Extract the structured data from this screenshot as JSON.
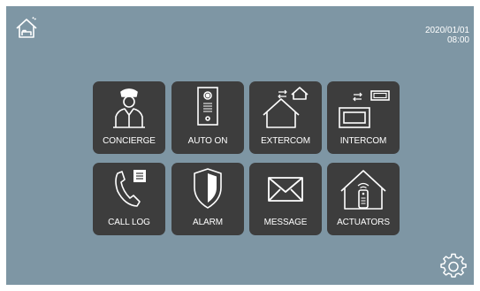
{
  "status": {
    "date": "2020/01/01",
    "time": "08:00"
  },
  "icons": {
    "home": "home-bed-icon",
    "settings": "gear-icon"
  },
  "tiles": [
    {
      "label": "CONCIERGE",
      "icon": "concierge-icon"
    },
    {
      "label": "AUTO ON",
      "icon": "door-panel-icon"
    },
    {
      "label": "EXTERCOM",
      "icon": "extercom-icon"
    },
    {
      "label": "INTERCOM",
      "icon": "intercom-icon"
    },
    {
      "label": "CALL LOG",
      "icon": "phone-log-icon"
    },
    {
      "label": "ALARM",
      "icon": "shield-icon"
    },
    {
      "label": "MESSAGE",
      "icon": "envelope-icon"
    },
    {
      "label": "ACTUATORS",
      "icon": "remote-home-icon"
    }
  ],
  "colors": {
    "background": "#7e96a4",
    "tile": "#3d3d3d",
    "foreground": "#ffffff"
  }
}
